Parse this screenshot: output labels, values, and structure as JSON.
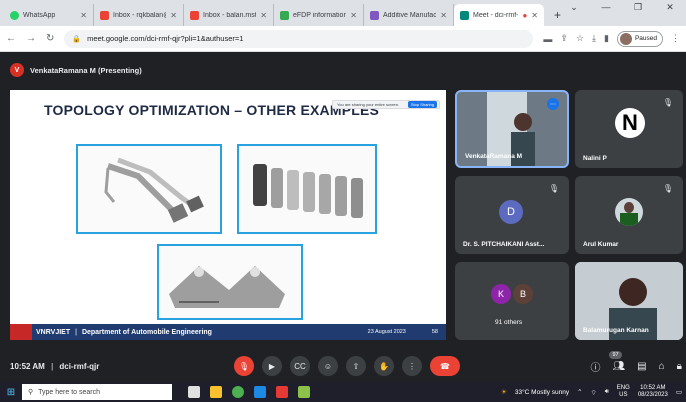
{
  "browser": {
    "tabs": [
      {
        "label": "WhatsApp",
        "color": "#25d366"
      },
      {
        "label": "Inbox - rqkbalan@",
        "color": "#ea4335"
      },
      {
        "label": "Inbox - balan.mst",
        "color": "#ea4335"
      },
      {
        "label": "eFDP informations",
        "color": "#34a853"
      },
      {
        "label": "Additive Manufactu",
        "color": "#7e57c2"
      },
      {
        "label": "Meet - dci-rmf-",
        "color": "#00897b"
      }
    ],
    "new_tab": "+",
    "url": "meet.google.com/dci-rmf-qjr?pli=1&authuser=1",
    "paused_label": "Paused"
  },
  "meet": {
    "presenter_initial": "V",
    "presenter_label": "VenkataRamana M (Presenting)",
    "slide": {
      "title": "TOPOLOGY OPTIMIZATION – OTHER EXAMPLES",
      "share_banner_text": "You are sharing your entire screen.",
      "share_banner_stop": "Stop Sharing",
      "footer_org": "VNRVJIET",
      "footer_dept": "Department of Automobile Engineering",
      "footer_date": "23 August 2023",
      "footer_page": "58"
    },
    "tiles": [
      {
        "name": "VenkataRamana M"
      },
      {
        "name": "Nalini P",
        "initial": "N"
      },
      {
        "name": "Dr. S. PITCHAIKANI Asst...",
        "initial": "D"
      },
      {
        "name": "Arul Kumar"
      },
      {
        "name": "91 others",
        "initials": [
          "K",
          "B"
        ]
      },
      {
        "name": "Balamurugan Karnan"
      }
    ],
    "meeting_time": "10:52 AM",
    "meeting_code": "dci-rmf-qjr",
    "participant_count": "97"
  },
  "taskbar": {
    "search_placeholder": "Type here to search",
    "weather": "33°C  Mostly sunny",
    "lang": "ENG",
    "region": "US",
    "time": "10:52 AM",
    "date": "08/23/2023"
  }
}
